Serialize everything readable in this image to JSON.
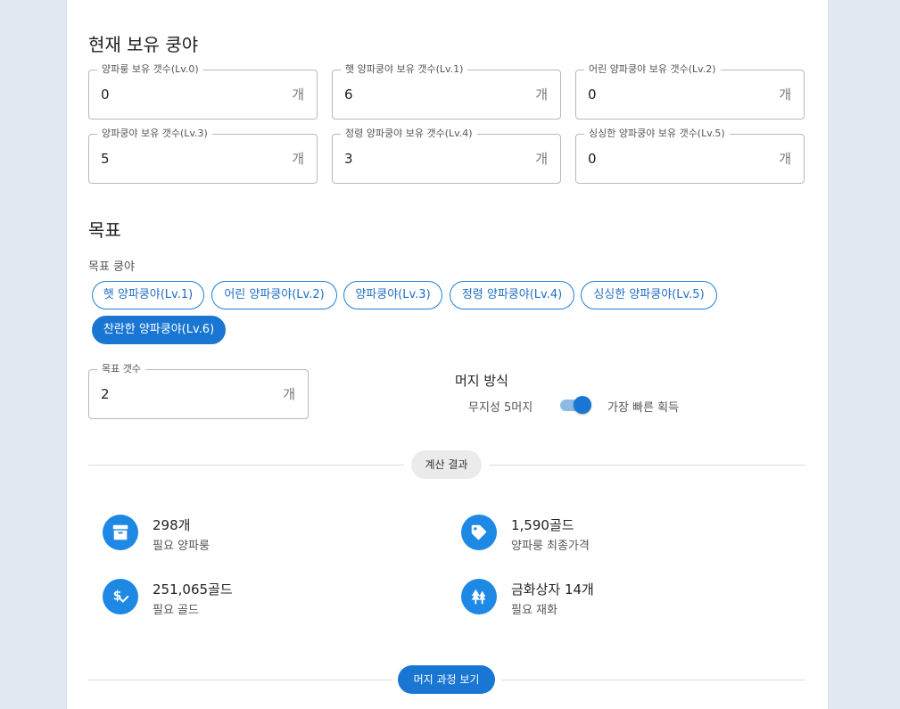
{
  "sections": {
    "current_title": "현재 보유 쿵야",
    "target_title": "목표"
  },
  "holdings": [
    {
      "label": "양파룽 보유 갯수(Lv.0)",
      "value": "0",
      "suffix": "개"
    },
    {
      "label": "햇 양파쿵야 보유 갯수(Lv.1)",
      "value": "6",
      "suffix": "개"
    },
    {
      "label": "어린 양파쿵야 보유 갯수(Lv.2)",
      "value": "0",
      "suffix": "개"
    },
    {
      "label": "양파쿵야 보유 갯수(Lv.3)",
      "value": "5",
      "suffix": "개"
    },
    {
      "label": "정령 양파쿵야 보유 갯수(Lv.4)",
      "value": "3",
      "suffix": "개"
    },
    {
      "label": "싱싱한 양파쿵야 보유 갯수(Lv.5)",
      "value": "0",
      "suffix": "개"
    }
  ],
  "target": {
    "kind_label": "목표 쿵야",
    "chips": [
      {
        "label": "햇 양파쿵야(Lv.1)",
        "selected": false
      },
      {
        "label": "어린 양파쿵야(Lv.2)",
        "selected": false
      },
      {
        "label": "양파쿵야(Lv.3)",
        "selected": false
      },
      {
        "label": "정령 양파쿵야(Lv.4)",
        "selected": false
      },
      {
        "label": "싱싱한 양파쿵야(Lv.5)",
        "selected": false
      },
      {
        "label": "찬란한 양파쿵야(Lv.6)",
        "selected": true
      }
    ],
    "count_label": "목표 갯수",
    "count_value": "2",
    "count_suffix": "개"
  },
  "merge": {
    "title": "머지 방식",
    "left_label": "무지성 5머지",
    "right_label": "가장 빠른 획득",
    "toggle_on": true
  },
  "results": {
    "divider_label": "계산 결과",
    "items": [
      {
        "icon": "archive-box-icon",
        "main": "298개",
        "sub": "필요 양파룽"
      },
      {
        "icon": "price-tag-icon",
        "main": "1,590골드",
        "sub": "양파룽 최종가격"
      },
      {
        "icon": "dollar-check-icon",
        "main": "251,065골드",
        "sub": "필요 골드"
      },
      {
        "icon": "forest-icon",
        "main": "금화상자 14개",
        "sub": "필요 재화"
      }
    ],
    "merge_process_button": "머지 과정 보기"
  },
  "colors": {
    "primary": "#1976d2",
    "icon_bg": "#1e88e5",
    "page_bg": "#e1e8f2"
  }
}
